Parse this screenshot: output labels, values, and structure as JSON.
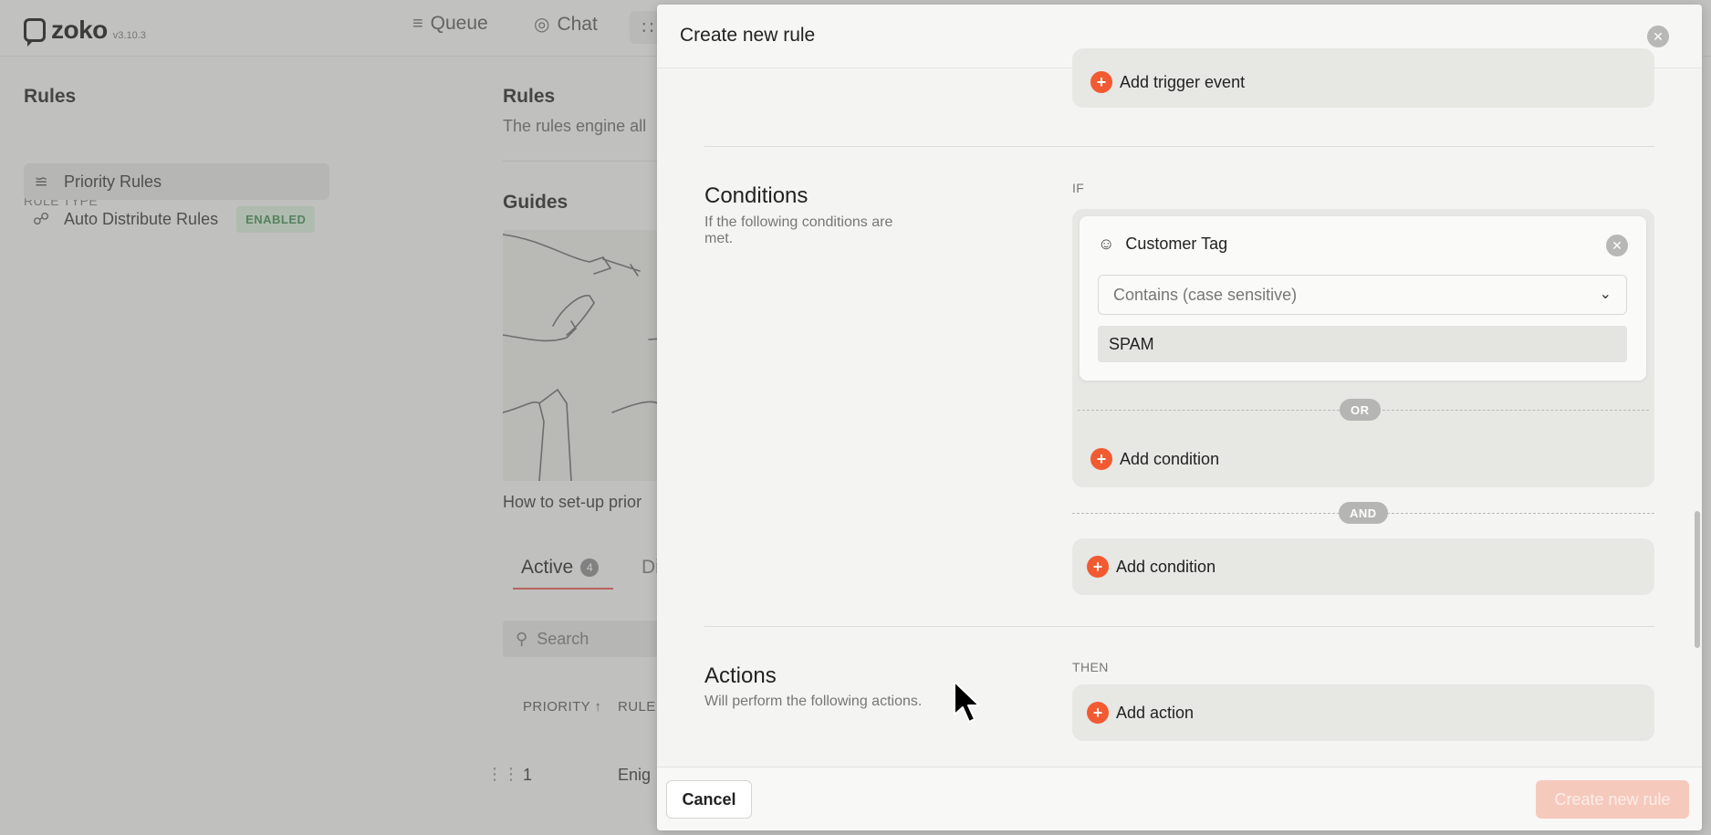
{
  "app": {
    "logo_text": "zoko",
    "version": "v3.10.3",
    "nav": {
      "queue": "Queue",
      "chat": "Chat"
    }
  },
  "sidebar": {
    "title": "Rules",
    "section_label": "RULE TYPE",
    "items": [
      {
        "label": "Priority Rules",
        "icon": "sliders-icon"
      },
      {
        "label": "Auto Distribute Rules",
        "icon": "share-icon",
        "badge": "ENABLED"
      }
    ]
  },
  "main": {
    "title": "Rules",
    "description": "The rules engine all",
    "guides_title": "Guides",
    "guide_caption": "How to set-up prior",
    "tabs": [
      {
        "label": "Active",
        "count": "4"
      },
      {
        "label": "Di"
      }
    ],
    "search_placeholder": "Search",
    "table": {
      "headers": [
        "PRIORITY ↑",
        "RULE"
      ],
      "rows": [
        {
          "priority": "1",
          "name": "Enig"
        }
      ]
    }
  },
  "modal": {
    "title": "Create new rule",
    "trigger": {
      "add_label": "Add trigger event"
    },
    "conditions": {
      "title": "Conditions",
      "description": "If the following conditions are met.",
      "label": "IF",
      "condition": {
        "field": "Customer Tag",
        "operator": "Contains (case sensitive)",
        "value": "SPAM"
      },
      "or_label": "OR",
      "and_label": "AND",
      "add_condition_label": "Add condition"
    },
    "actions": {
      "title": "Actions",
      "description": "Will perform the following actions.",
      "label": "THEN",
      "add_label": "Add action"
    },
    "footer": {
      "cancel": "Cancel",
      "create": "Create new rule"
    }
  },
  "colors": {
    "accent": "#f25a32",
    "enabled_badge_text": "#3d8a4d",
    "tab_underline": "#e2574c"
  }
}
